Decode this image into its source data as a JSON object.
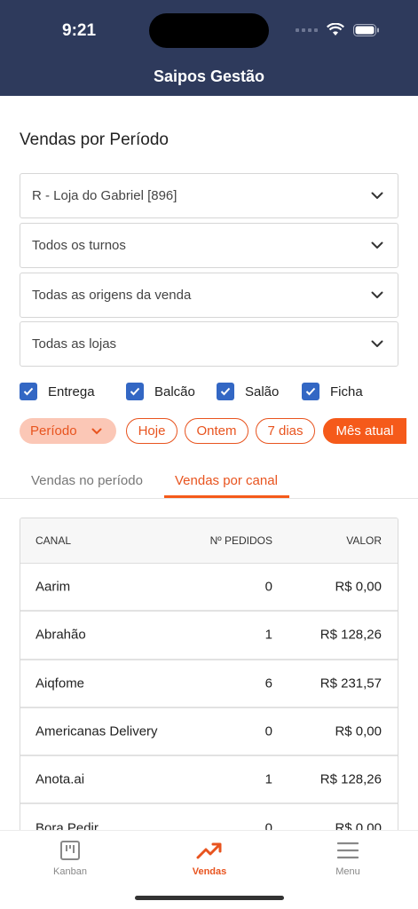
{
  "status_bar": {
    "time": "9:21"
  },
  "header": {
    "title": "Saipos Gestão"
  },
  "page": {
    "title": "Vendas por Período"
  },
  "filters": {
    "store": "R - Loja do Gabriel [896]",
    "shift": "Todos os turnos",
    "origin": "Todas as origens da venda",
    "stores": "Todas as lojas"
  },
  "checkboxes": [
    {
      "label": "Entrega",
      "checked": true
    },
    {
      "label": "Balcão",
      "checked": true
    },
    {
      "label": "Salão",
      "checked": true
    },
    {
      "label": "Ficha",
      "checked": true
    }
  ],
  "period_chips": {
    "periodo": "Período",
    "hoje": "Hoje",
    "ontem": "Ontem",
    "sete_dias": "7 dias",
    "mes_atual": "Mês atual"
  },
  "tabs": {
    "periodo": "Vendas no período",
    "canal": "Vendas por canal"
  },
  "table": {
    "headers": {
      "canal": "CANAL",
      "pedidos": "Nº PEDIDOS",
      "valor": "VALOR"
    },
    "rows": [
      {
        "canal": "Aarim",
        "pedidos": "0",
        "valor": "R$ 0,00"
      },
      {
        "canal": "Abrahão",
        "pedidos": "1",
        "valor": "R$ 128,26"
      },
      {
        "canal": "Aiqfome",
        "pedidos": "6",
        "valor": "R$ 231,57"
      },
      {
        "canal": "Americanas Delivery",
        "pedidos": "0",
        "valor": "R$ 0,00"
      },
      {
        "canal": "Anota.ai",
        "pedidos": "1",
        "valor": "R$ 128,26"
      },
      {
        "canal": "Bora Pedir",
        "pedidos": "0",
        "valor": "R$ 0,00"
      }
    ]
  },
  "bottom_nav": {
    "kanban": "Kanban",
    "vendas": "Vendas",
    "menu": "Menu"
  },
  "colors": {
    "header_bg": "#2e3a5c",
    "accent": "#f55a1a",
    "checkbox": "#3367c4"
  }
}
